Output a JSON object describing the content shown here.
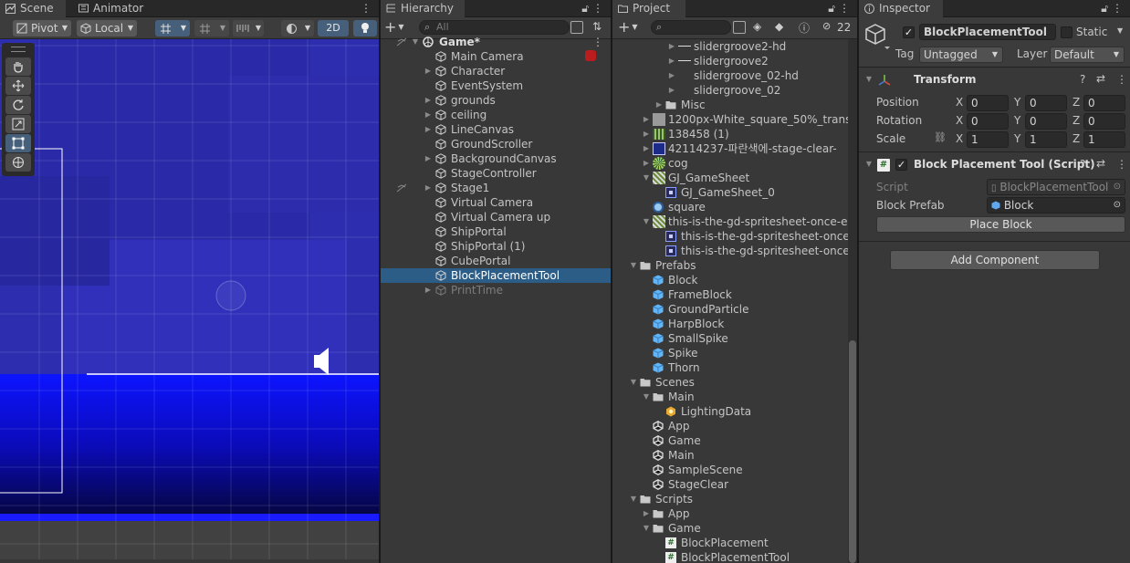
{
  "scene": {
    "tabs": [
      "Scene",
      "Animator"
    ],
    "pivot_label": "Pivot",
    "local_label": "Local",
    "twod_label": "2D"
  },
  "hierarchy": {
    "tab": "Hierarchy",
    "search_placeholder": "All",
    "root": "Game*",
    "items": [
      {
        "label": "Main Camera",
        "arrow": false
      },
      {
        "label": "Character",
        "arrow": true
      },
      {
        "label": "EventSystem",
        "arrow": false
      },
      {
        "label": "grounds",
        "arrow": true
      },
      {
        "label": "ceiling",
        "arrow": true
      },
      {
        "label": "LineCanvas",
        "arrow": true
      },
      {
        "label": "GroundScroller",
        "arrow": false
      },
      {
        "label": "BackgroundCanvas",
        "arrow": true
      },
      {
        "label": "StageController",
        "arrow": false
      },
      {
        "label": "Stage1",
        "arrow": true
      },
      {
        "label": "Virtual Camera",
        "arrow": false
      },
      {
        "label": "Virtual Camera up",
        "arrow": false
      },
      {
        "label": "ShipPortal",
        "arrow": false
      },
      {
        "label": "ShipPortal (1)",
        "arrow": false
      },
      {
        "label": "CubePortal",
        "arrow": false
      },
      {
        "label": "BlockPlacementTool",
        "arrow": false,
        "selected": true
      },
      {
        "label": "PrintTime",
        "arrow": true,
        "dim": true
      }
    ]
  },
  "project": {
    "tab": "Project",
    "hidden_count": "22",
    "items": [
      {
        "label": "slidergroove2-hd",
        "indent": 4,
        "arrow": "right",
        "icon": "line"
      },
      {
        "label": "slidergroove2",
        "indent": 4,
        "arrow": "right",
        "icon": "line"
      },
      {
        "label": "slidergroove_02-hd",
        "indent": 4,
        "arrow": "right",
        "icon": "none"
      },
      {
        "label": "slidergroove_02",
        "indent": 4,
        "arrow": "right",
        "icon": "none"
      },
      {
        "label": "Misc",
        "indent": 3,
        "arrow": "right",
        "icon": "folder"
      },
      {
        "label": "1200px-White_square_50%_transp",
        "indent": 2,
        "arrow": "right",
        "icon": "gray"
      },
      {
        "label": "138458 (1)",
        "indent": 2,
        "arrow": "right",
        "icon": "sprite-green"
      },
      {
        "label": "42114237-파란색에-stage-clear-",
        "indent": 2,
        "arrow": "right",
        "icon": "sprite-blue"
      },
      {
        "label": "cog",
        "indent": 2,
        "arrow": "right",
        "icon": "sprite-cog"
      },
      {
        "label": "GJ_GameSheet",
        "indent": 2,
        "arrow": "down",
        "icon": "sprite-sheet"
      },
      {
        "label": "GJ_GameSheet_0",
        "indent": 3,
        "arrow": "none",
        "icon": "subsprite"
      },
      {
        "label": "square",
        "indent": 2,
        "arrow": "none",
        "icon": "circle"
      },
      {
        "label": "this-is-the-gd-spritesheet-once-e",
        "indent": 2,
        "arrow": "down",
        "icon": "sprite-sheet"
      },
      {
        "label": "this-is-the-gd-spritesheet-once",
        "indent": 3,
        "arrow": "none",
        "icon": "subsprite"
      },
      {
        "label": "this-is-the-gd-spritesheet-once",
        "indent": 3,
        "arrow": "none",
        "icon": "subsprite"
      },
      {
        "label": "Prefabs",
        "indent": 1,
        "arrow": "down",
        "icon": "folder"
      },
      {
        "label": "Block",
        "indent": 2,
        "arrow": "none",
        "icon": "prefab"
      },
      {
        "label": "FrameBlock",
        "indent": 2,
        "arrow": "none",
        "icon": "prefab"
      },
      {
        "label": "GroundParticle",
        "indent": 2,
        "arrow": "none",
        "icon": "prefab"
      },
      {
        "label": "HarpBlock",
        "indent": 2,
        "arrow": "none",
        "icon": "prefab"
      },
      {
        "label": "SmallSpike",
        "indent": 2,
        "arrow": "none",
        "icon": "prefab"
      },
      {
        "label": "Spike",
        "indent": 2,
        "arrow": "none",
        "icon": "prefab"
      },
      {
        "label": "Thorn",
        "indent": 2,
        "arrow": "none",
        "icon": "prefab"
      },
      {
        "label": "Scenes",
        "indent": 1,
        "arrow": "down",
        "icon": "folder"
      },
      {
        "label": "Main",
        "indent": 2,
        "arrow": "down",
        "icon": "folder"
      },
      {
        "label": "LightingData",
        "indent": 3,
        "arrow": "none",
        "icon": "lighting"
      },
      {
        "label": "App",
        "indent": 2,
        "arrow": "none",
        "icon": "unity"
      },
      {
        "label": "Game",
        "indent": 2,
        "arrow": "none",
        "icon": "unity"
      },
      {
        "label": "Main",
        "indent": 2,
        "arrow": "none",
        "icon": "unity"
      },
      {
        "label": "SampleScene",
        "indent": 2,
        "arrow": "none",
        "icon": "unity"
      },
      {
        "label": "StageClear",
        "indent": 2,
        "arrow": "none",
        "icon": "unity"
      },
      {
        "label": "Scripts",
        "indent": 1,
        "arrow": "down",
        "icon": "folder"
      },
      {
        "label": "App",
        "indent": 2,
        "arrow": "right",
        "icon": "folder"
      },
      {
        "label": "Game",
        "indent": 2,
        "arrow": "down",
        "icon": "folder"
      },
      {
        "label": "BlockPlacement",
        "indent": 3,
        "arrow": "none",
        "icon": "script"
      },
      {
        "label": "BlockPlacementTool",
        "indent": 3,
        "arrow": "none",
        "icon": "script"
      }
    ]
  },
  "inspector": {
    "tab": "Inspector",
    "object_name": "BlockPlacementTool",
    "static_label": "Static",
    "tag_label": "Tag",
    "tag_value": "Untagged",
    "layer_label": "Layer",
    "layer_value": "Default",
    "transform": {
      "title": "Transform",
      "rows": [
        {
          "label": "Position",
          "x": "0",
          "y": "0",
          "z": "0"
        },
        {
          "label": "Rotation",
          "x": "0",
          "y": "0",
          "z": "0"
        },
        {
          "label": "Scale",
          "x": "1",
          "y": "1",
          "z": "1"
        }
      ]
    },
    "script_component": {
      "title": "Block Placement Tool (Script)",
      "script_label": "Script",
      "script_value": "BlockPlacementTool",
      "prefab_label": "Block Prefab",
      "prefab_value": "Block",
      "place_button": "Place Block"
    },
    "add_component": "Add Component"
  }
}
